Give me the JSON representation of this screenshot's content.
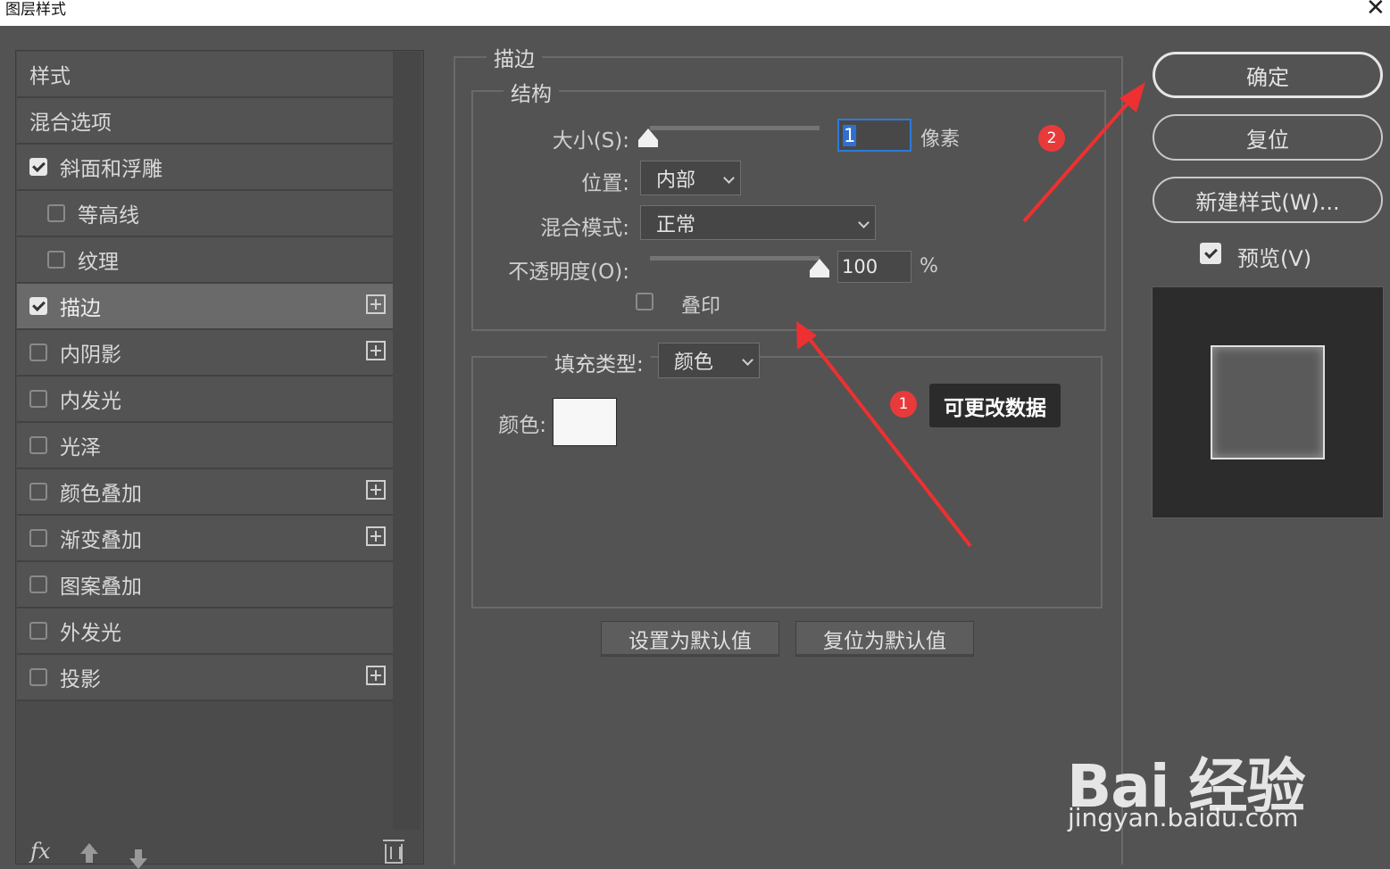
{
  "window": {
    "title": "图层样式"
  },
  "styles_header": "样式",
  "blend_options": "混合选项",
  "style_items": [
    {
      "label": "斜面和浮雕",
      "checked": true,
      "indent": false,
      "plus": false,
      "selected": false
    },
    {
      "label": "等高线",
      "checked": false,
      "indent": true,
      "plus": false,
      "selected": false
    },
    {
      "label": "纹理",
      "checked": false,
      "indent": true,
      "plus": false,
      "selected": false
    },
    {
      "label": "描边",
      "checked": true,
      "indent": false,
      "plus": true,
      "selected": true
    },
    {
      "label": "内阴影",
      "checked": false,
      "indent": false,
      "plus": true,
      "selected": false
    },
    {
      "label": "内发光",
      "checked": false,
      "indent": false,
      "plus": false,
      "selected": false
    },
    {
      "label": "光泽",
      "checked": false,
      "indent": false,
      "plus": false,
      "selected": false
    },
    {
      "label": "颜色叠加",
      "checked": false,
      "indent": false,
      "plus": true,
      "selected": false
    },
    {
      "label": "渐变叠加",
      "checked": false,
      "indent": false,
      "plus": true,
      "selected": false
    },
    {
      "label": "图案叠加",
      "checked": false,
      "indent": false,
      "plus": false,
      "selected": false
    },
    {
      "label": "外发光",
      "checked": false,
      "indent": false,
      "plus": false,
      "selected": false
    },
    {
      "label": "投影",
      "checked": false,
      "indent": false,
      "plus": true,
      "selected": false
    }
  ],
  "footer": {
    "fx_label": "fx"
  },
  "stroke": {
    "title": "描边",
    "structure": {
      "title": "结构",
      "size_label": "大小(S):",
      "size_value": "1",
      "size_unit": "像素",
      "position_label": "位置:",
      "position_value": "内部",
      "blend_label": "混合模式:",
      "blend_value": "正常",
      "opacity_label": "不透明度(O):",
      "opacity_value": "100",
      "opacity_unit": "%",
      "overprint_label": "叠印"
    },
    "fill": {
      "type_label": "填充类型:",
      "type_value": "颜色",
      "color_label": "颜色:",
      "color_hex": "#f7f7f7"
    },
    "set_default": "设置为默认值",
    "reset_default": "复位为默认值"
  },
  "actions": {
    "ok": "确定",
    "reset": "复位",
    "new_style": "新建样式(W)...",
    "preview_label": "预览(V)",
    "preview_checked": true
  },
  "annotations": {
    "badge1": "1",
    "badge2": "2",
    "tooltip": "可更改数据",
    "color": "#e83a3a"
  },
  "watermark": {
    "logo": "Bai 经验",
    "url": "jingyan.baidu.com"
  }
}
